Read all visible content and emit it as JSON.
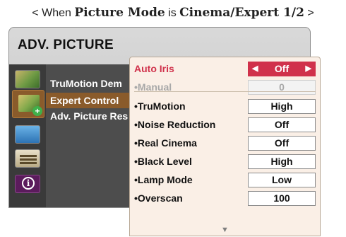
{
  "caption": {
    "prefix": "< When ",
    "mode_name": "Picture Mode",
    "middle": " is ",
    "mode_value": "Cinema/Expert 1/2",
    "suffix": " >"
  },
  "adv_picture": {
    "title": "ADV. PICTURE",
    "items": [
      {
        "label": "TruMotion Dem"
      },
      {
        "label": "Expert Control",
        "selected": true
      },
      {
        "label": "Adv. Picture Res"
      }
    ],
    "icons": [
      "picture-icon",
      "expert-control-icon",
      "screen-icon",
      "option-tools-icon",
      "info-icon"
    ]
  },
  "submenu": {
    "rows": [
      {
        "label": "Auto Iris",
        "value": "Off",
        "state": "active"
      },
      {
        "label": "•Manual",
        "value": "0",
        "state": "disabled"
      },
      {
        "label": "•TruMotion",
        "value": "High"
      },
      {
        "label": "•Noise Reduction",
        "value": "Off"
      },
      {
        "label": "•Real Cinema",
        "value": "Off"
      },
      {
        "label": "•Black Level",
        "value": "High"
      },
      {
        "label": "•Lamp Mode",
        "value": "Low"
      },
      {
        "label": "•Overscan",
        "value": "100"
      }
    ],
    "arrow_left": "◀",
    "arrow_right": "▶",
    "scroll_arrow": "▼"
  },
  "colors": {
    "accent": "#d0314b",
    "submenu_bg": "#faefe6",
    "menu_body": "#4d4d4d",
    "selected_item": "#8a5b2b"
  }
}
